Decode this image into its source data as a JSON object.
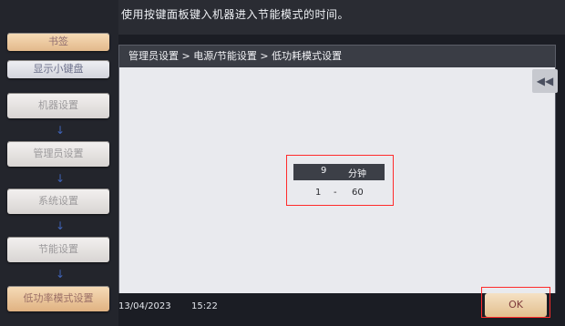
{
  "top_message": "使用按键面板键入机器进入节能模式的时间。",
  "sidebar": {
    "bookmark": "书签",
    "show_keypad": "显示小键盘",
    "items": [
      {
        "label": "机器设置"
      },
      {
        "label": "管理员设置"
      },
      {
        "label": "系统设置"
      },
      {
        "label": "节能设置"
      },
      {
        "label": "低功率模式设置"
      }
    ],
    "arrow": "↓"
  },
  "breadcrumb": "管理员设置 > 电源/节能设置 > 低功耗模式设置",
  "collapse_icon": "◀◀",
  "setting": {
    "value": "9",
    "unit": "分钟",
    "range_min": "1",
    "range_sep": "-",
    "range_max": "60"
  },
  "status": {
    "date": "13/04/2023",
    "time": "15:22"
  },
  "ok_button": "OK",
  "colors": {
    "highlight_border": "#ff2b2b",
    "active_button": "#e0b282",
    "arrow": "#3f63b8"
  }
}
